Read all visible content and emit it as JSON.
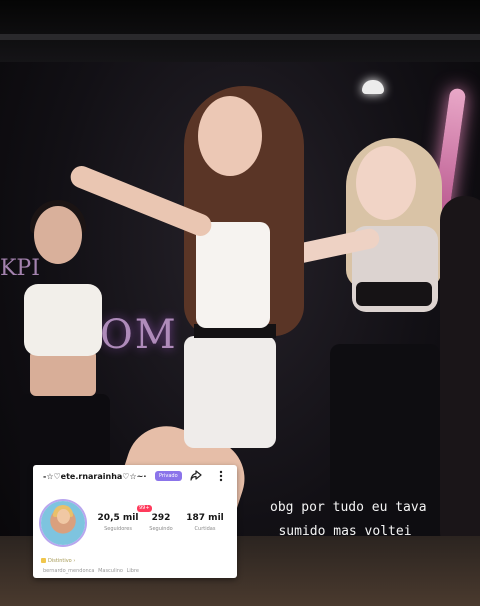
{
  "profile": {
    "username": "-☆♡ete.rnarainha♡☆~·",
    "badge": "Privado",
    "notif": "99+",
    "stats": [
      {
        "value": "20,5 mil",
        "label": "Seguidores"
      },
      {
        "value": "292",
        "label": "Seguindo"
      },
      {
        "value": "187 mil",
        "label": "Curtidas"
      }
    ],
    "distintivo": "Distintivo ›",
    "meta": "bernardo_mendonca   Masculino   Libre"
  },
  "caption": {
    "line1": "obg por tudo eu tava",
    "line2": "sumido mas voltei"
  },
  "background_sign": {
    "left": "KPI",
    "main": "OM"
  },
  "colors": {
    "badge": "#8b74ea",
    "neon": "#d77fb0",
    "caption": "#f4f4f4"
  }
}
